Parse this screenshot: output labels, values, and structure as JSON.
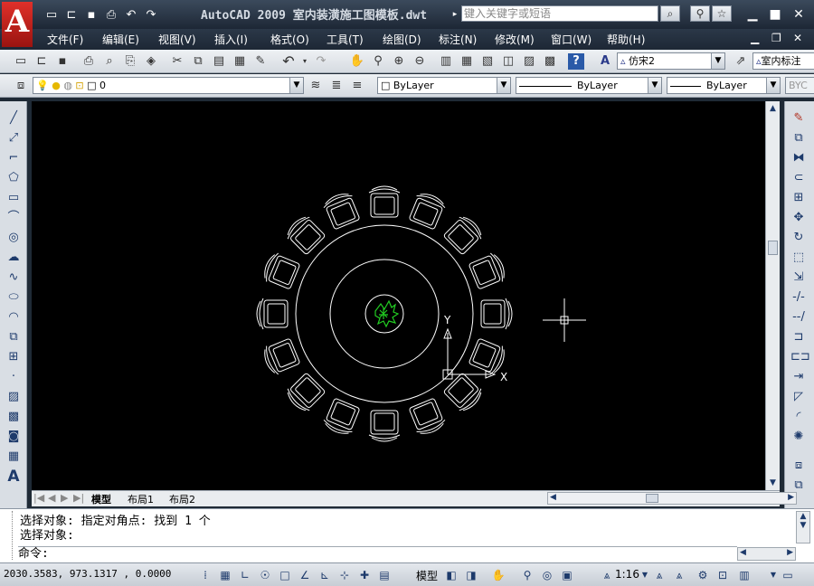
{
  "app": {
    "logo_letter": "A",
    "title": "AutoCAD 2009  室内装潢施工图模板.dwt",
    "search_placeholder": "键入关键字或短语"
  },
  "menu": [
    "文件(F)",
    "编辑(E)",
    "视图(V)",
    "插入(I)",
    "格式(O)",
    "工具(T)",
    "绘图(D)",
    "标注(N)",
    "修改(M)",
    "窗口(W)",
    "帮助(H)"
  ],
  "toolbar": {
    "text_style": "仿宋2",
    "dim_style": "室内标注",
    "layer": "0",
    "color": "ByLayer",
    "linetype": "ByLayer",
    "lineweight": "ByLayer",
    "plotstyle": "BYC"
  },
  "canvas": {
    "ucs_x": "X",
    "ucs_y": "Y",
    "background": "#000000",
    "line_color": "#ffffff",
    "plant_color": "#22cc22"
  },
  "tabs": [
    "模型",
    "布局1",
    "布局2"
  ],
  "command": {
    "line1": "选择对象: 指定对角点: 找到 1 个",
    "line2": "选择对象:",
    "prompt": "命令:"
  },
  "status": {
    "coords": "2030.3583, 973.1317 , 0.0000",
    "model_label": "模型",
    "annotation_scale": "1:16"
  }
}
